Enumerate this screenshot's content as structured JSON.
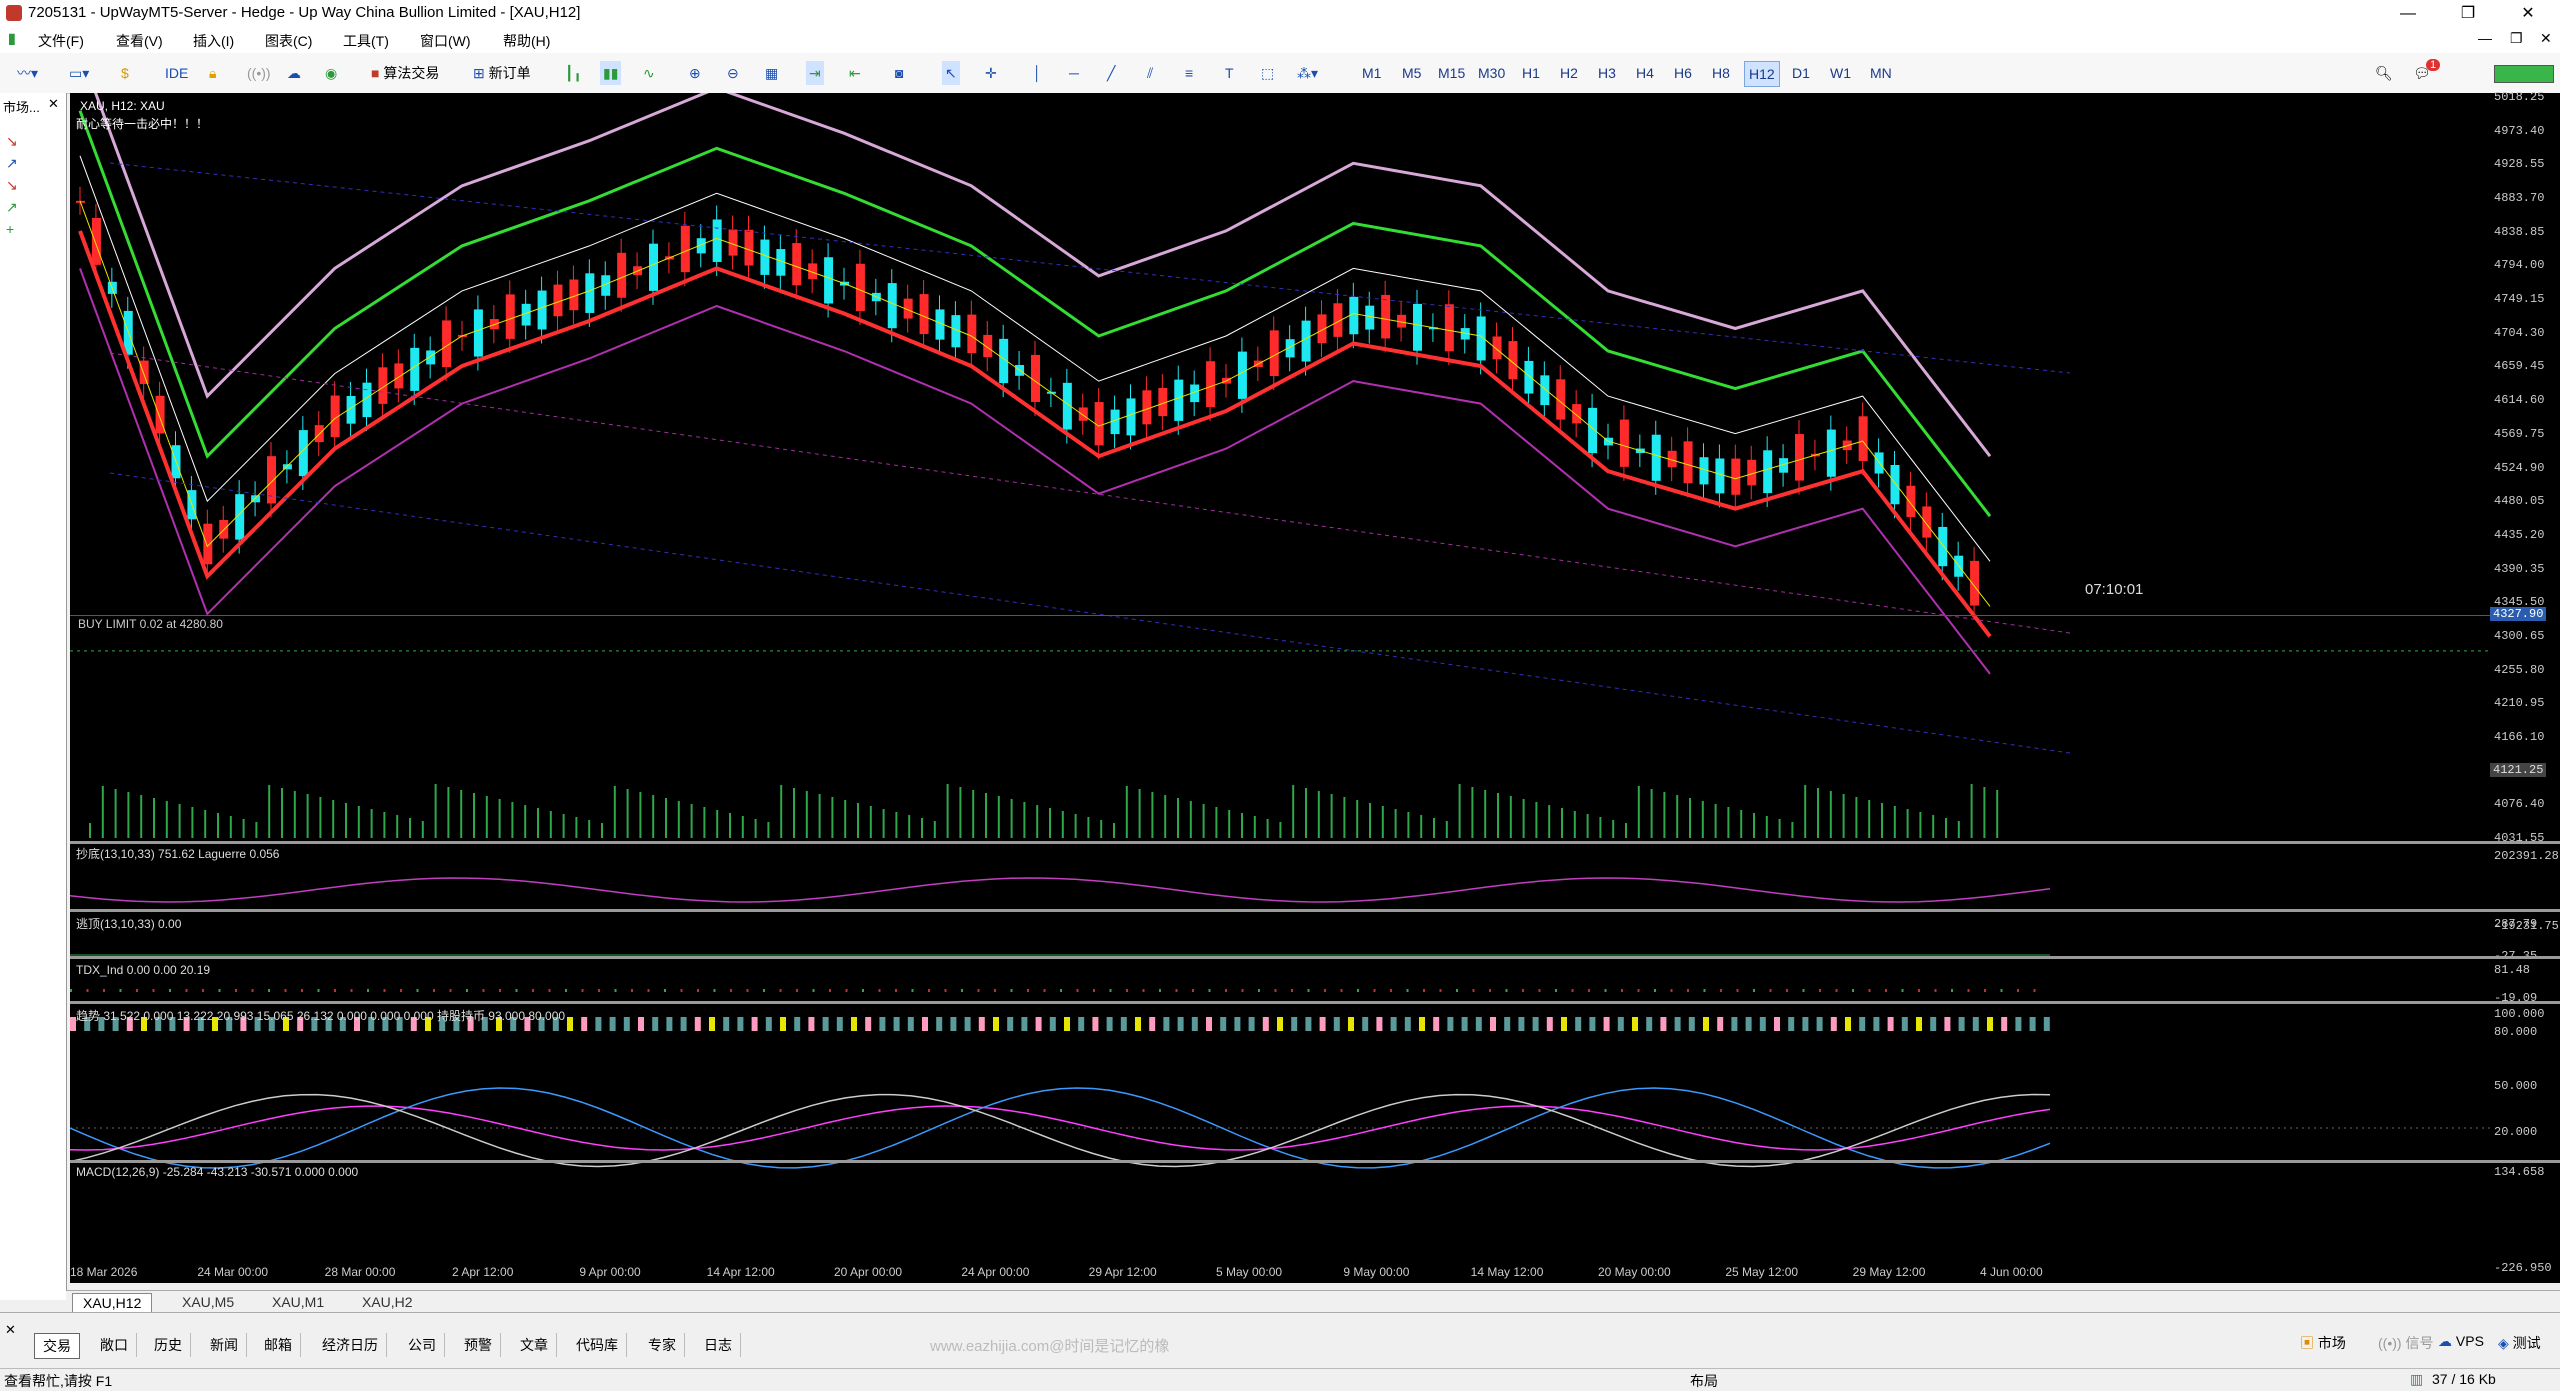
{
  "window": {
    "title": "7205131 - UpWayMT5-Server - Hedge - Up Way China Bullion Limited - [XAU,H12]"
  },
  "menu": [
    "文件(F)",
    "查看(V)",
    "插入(I)",
    "图表(C)",
    "工具(T)",
    "窗口(W)",
    "帮助(H)"
  ],
  "toolbar": {
    "ide": "IDE",
    "algo_trading": "算法交易",
    "new_order": "新订单",
    "timeframes": [
      "M1",
      "M5",
      "M15",
      "M30",
      "H1",
      "H2",
      "H3",
      "H4",
      "H6",
      "H8",
      "H12",
      "D1",
      "W1",
      "MN"
    ],
    "active_timeframe": "H12",
    "notification_count": "1"
  },
  "left_panel": {
    "label": "市场..."
  },
  "chart": {
    "header": "XAU, H12:  XAU",
    "subtitle": "耐心等待一击必中！！！",
    "order_label": "BUY LIMIT 0.02 at 4280.80",
    "countdown": "07:10:01",
    "current_price": "4327.90",
    "ask_price": "4121.25",
    "price_ticks": [
      "5018.25",
      "4973.40",
      "4928.55",
      "4883.70",
      "4838.85",
      "4794.00",
      "4749.15",
      "4704.30",
      "4659.45",
      "4614.60",
      "4569.75",
      "4524.90",
      "4480.05",
      "4435.20",
      "4390.35",
      "4345.50",
      "4300.65",
      "4255.80",
      "4210.95",
      "4166.10",
      "4121.25",
      "4076.40",
      "4031.55"
    ],
    "date_ticks": [
      "18 Mar 2026",
      "24 Mar 00:00",
      "28 Mar 00:00",
      "2 Apr 12:00",
      "9 Apr 00:00",
      "14 Apr 12:00",
      "20 Apr 00:00",
      "24 Apr 00:00",
      "29 Apr 12:00",
      "5 May 00:00",
      "9 May 00:00",
      "14 May 12:00",
      "20 May 00:00",
      "25 May 12:00",
      "29 May 12:00",
      "4 Jun 00:00"
    ],
    "indicators": [
      {
        "label": "抄底(13,10,33) 751.62 Laguerre 0.056",
        "scale_top": "202391.28",
        "scale_bottom": "-19231.75"
      },
      {
        "label": "逃顶(13,10,33) 0.00",
        "scale_top": "287.79",
        "scale_bottom": "-27.35"
      },
      {
        "label": "TDX_Ind 0.00 0.00 20.19",
        "scale_top": "81.48",
        "scale_bottom": "-19.09"
      },
      {
        "label": "趋势 31.522 0.000 13.222 20.993 15.065 26.132 0.000 0.000 0.000 持股持币 93.000 80.000",
        "scale_top": "100.000",
        "scale_mid1": "80.000",
        "scale_mid2": "50.000",
        "scale_bottom": "20.000"
      },
      {
        "label": "MACD(12,26,9) -25.284 -43.213 -30.571 0.000 0.000",
        "scale_top": "134.658",
        "scale_bottom": "-226.950"
      }
    ]
  },
  "chart_data": {
    "type": "candlestick",
    "symbol": "XAU",
    "timeframe": "H12",
    "x": [
      "18 Mar 2026",
      "24 Mar 00:00",
      "28 Mar 00:00",
      "2 Apr 12:00",
      "9 Apr 00:00",
      "14 Apr 12:00",
      "20 Apr 00:00",
      "24 Apr 00:00",
      "29 Apr 12:00",
      "5 May 00:00",
      "9 May 00:00",
      "14 May 12:00",
      "20 May 00:00",
      "25 May 12:00",
      "29 May 12:00",
      "4 Jun 00:00"
    ],
    "close": [
      4880,
      4420,
      4590,
      4700,
      4760,
      4830,
      4770,
      4700,
      4580,
      4640,
      4730,
      4700,
      4560,
      4510,
      4560,
      4340
    ],
    "ylim": [
      4031.55,
      5018.25
    ],
    "last_price": 4327.9
  },
  "chart_tabs": [
    "XAU,H12",
    "XAU,M5",
    "XAU,M1",
    "XAU,H2"
  ],
  "toolbox": {
    "tabs": [
      "交易",
      "敞口",
      "历史",
      "新闻",
      "邮箱",
      "经济日历",
      "公司",
      "预警",
      "文章",
      "代码库",
      "专家",
      "日志"
    ],
    "right": [
      "市场",
      "信号",
      "VPS",
      "测试"
    ]
  },
  "status": {
    "help": "查看帮忙,请按 F1",
    "layout": "布局",
    "traffic": "37 / 16 Kb"
  },
  "watermark": "www.eazhijia.com@时间是记忆的橡"
}
